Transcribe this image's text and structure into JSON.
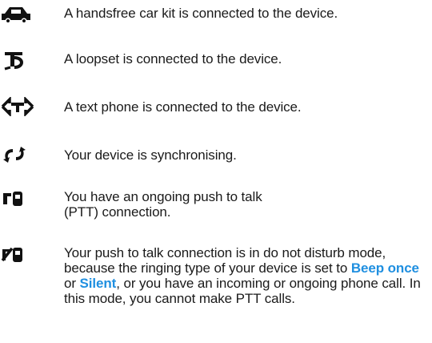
{
  "indicators": [
    {
      "icon": "car-kit-icon",
      "text": "A handsfree car kit is connected to the device."
    },
    {
      "icon": "loopset-icon",
      "text": "A loopset is connected to the device."
    },
    {
      "icon": "text-phone-icon",
      "text": "A text phone is connected to the device."
    },
    {
      "icon": "sync-icon",
      "text": "Your device is synchronising."
    },
    {
      "icon": "ptt-connection-icon",
      "text": "You have an ongoing push to talk (PTT) connection."
    },
    {
      "icon": "ptt-do-not-disturb-icon",
      "text_before": "Your push to talk connection is in do not disturb mode, because the ringing type of your device is set to ",
      "option_beep_once": "Beep once",
      "text_or": " or ",
      "option_silent": "Silent",
      "text_after": ", or you have an incoming or ongoing phone call. In this mode, you cannot make PTT calls."
    }
  ],
  "colors": {
    "highlight": "#1f8fe0",
    "icon": "#111111",
    "text": "#1a1a1a"
  }
}
